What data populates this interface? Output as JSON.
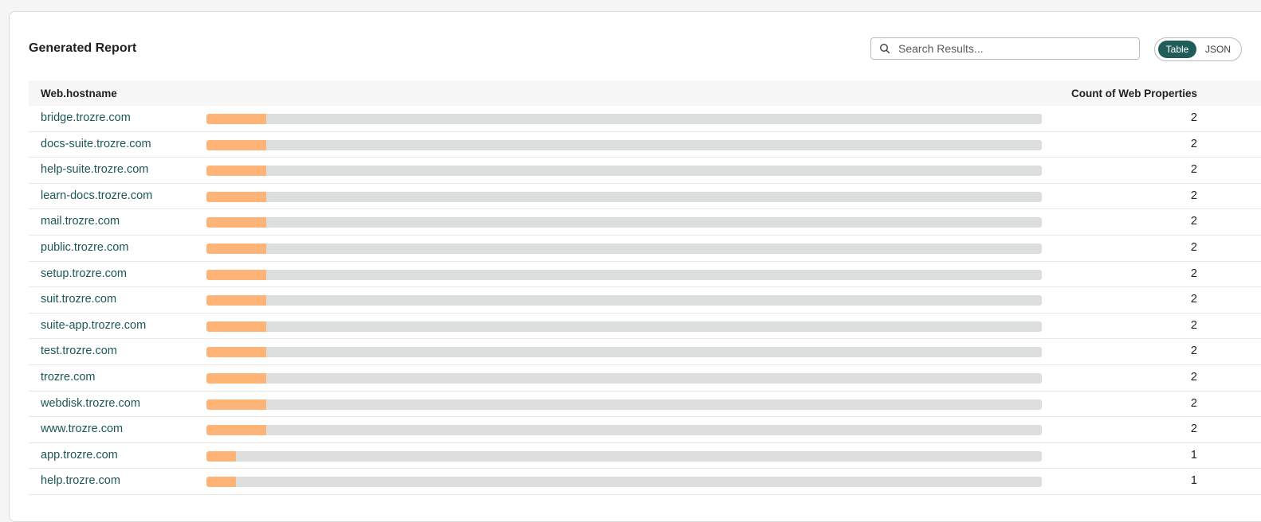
{
  "report": {
    "title": "Generated Report",
    "search": {
      "placeholder": "Search Results...",
      "value": ""
    },
    "view_toggle": {
      "options": [
        "Table",
        "JSON"
      ],
      "selected": "Table"
    },
    "columns": {
      "host": "Web.hostname",
      "count": "Count of Web Properties"
    },
    "max_count": 28,
    "rows": [
      {
        "host": "bridge.trozre.com",
        "count": 2
      },
      {
        "host": "docs-suite.trozre.com",
        "count": 2
      },
      {
        "host": "help-suite.trozre.com",
        "count": 2
      },
      {
        "host": "learn-docs.trozre.com",
        "count": 2
      },
      {
        "host": "mail.trozre.com",
        "count": 2
      },
      {
        "host": "public.trozre.com",
        "count": 2
      },
      {
        "host": "setup.trozre.com",
        "count": 2
      },
      {
        "host": "suit.trozre.com",
        "count": 2
      },
      {
        "host": "suite-app.trozre.com",
        "count": 2
      },
      {
        "host": "test.trozre.com",
        "count": 2
      },
      {
        "host": "trozre.com",
        "count": 2
      },
      {
        "host": "webdisk.trozre.com",
        "count": 2
      },
      {
        "host": "www.trozre.com",
        "count": 2
      },
      {
        "host": "app.trozre.com",
        "count": 1
      },
      {
        "host": "help.trozre.com",
        "count": 1
      }
    ]
  },
  "colors": {
    "accent": "#1f5c5a",
    "bar_fill": "#ffb477",
    "bar_track": "#dcdedd",
    "link": "#1b5755"
  },
  "icons": {
    "search": "search-icon"
  }
}
